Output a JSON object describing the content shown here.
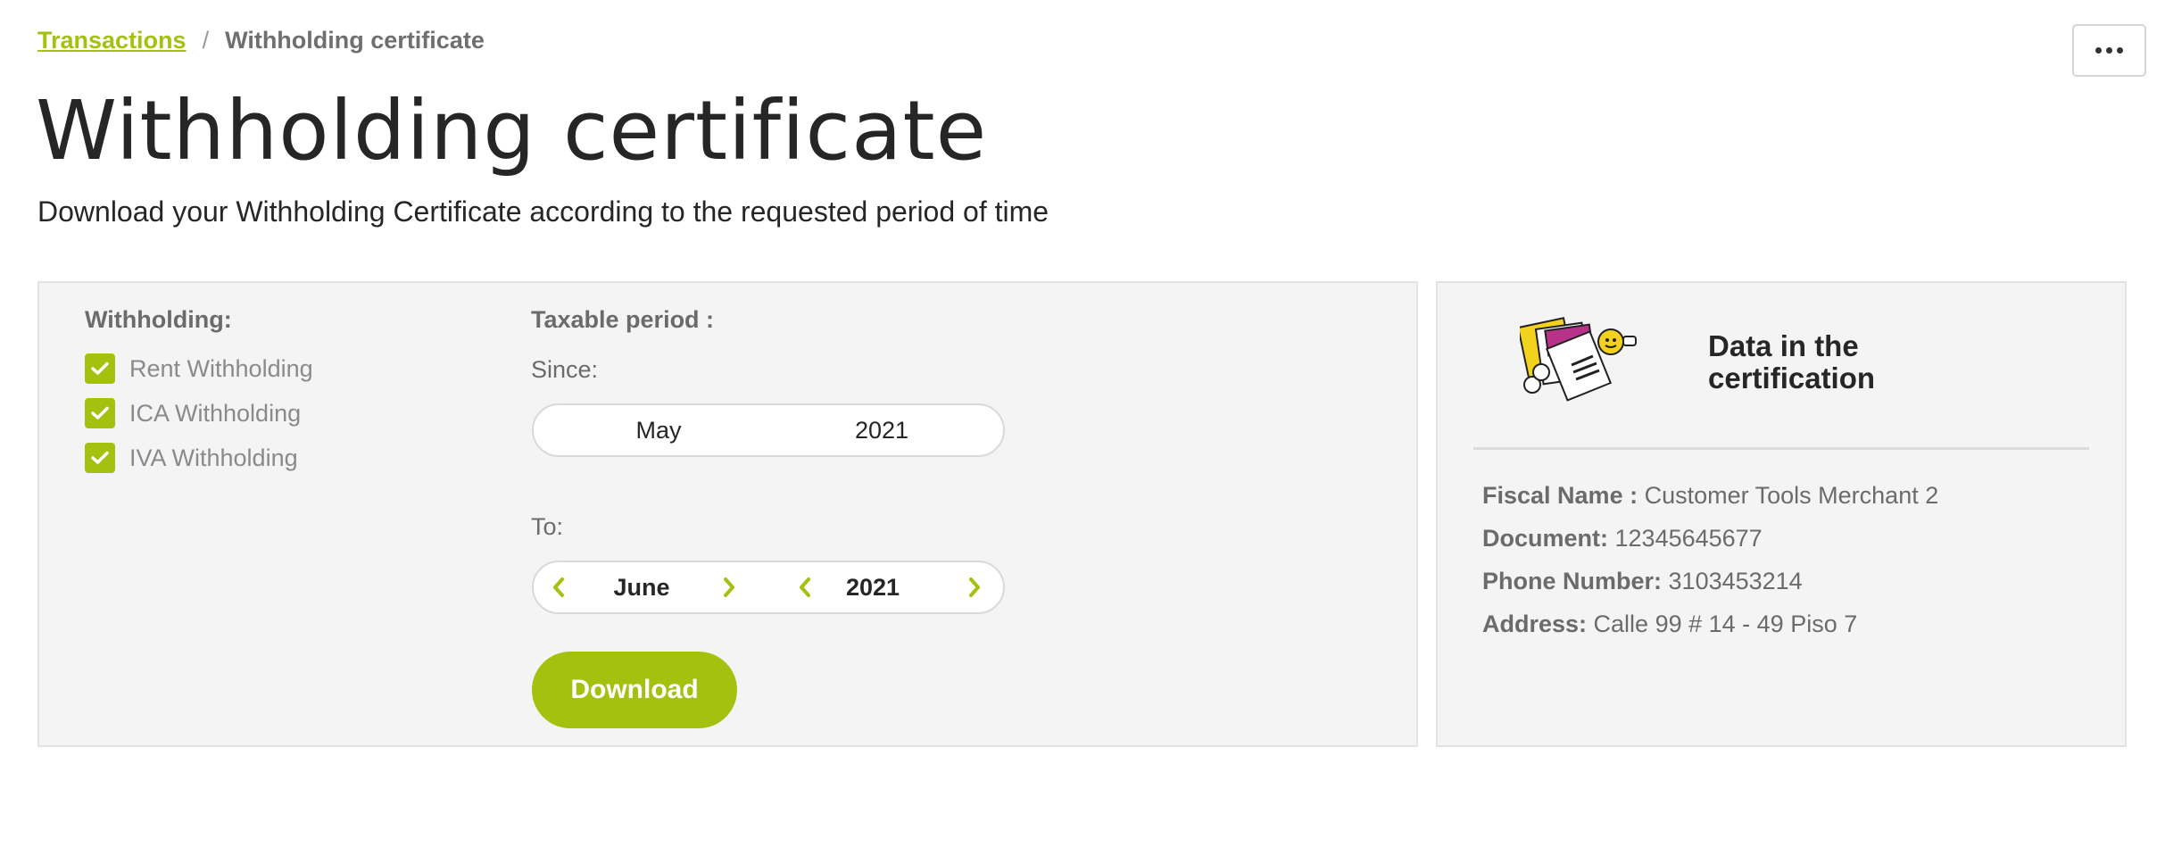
{
  "breadcrumb": {
    "link": "Transactions",
    "separator": "/",
    "current": "Withholding certificate"
  },
  "page": {
    "title": "Withholding certificate",
    "subtitle": "Download your Withholding Certificate according to the requested period of time"
  },
  "withholding": {
    "label": "Withholding:",
    "options": [
      {
        "label": "Rent Withholding",
        "checked": true
      },
      {
        "label": "ICA Withholding",
        "checked": true
      },
      {
        "label": "IVA Withholding",
        "checked": true
      }
    ]
  },
  "period": {
    "label": "Taxable period :",
    "since_label": "Since:",
    "since_month": "May",
    "since_year": "2021",
    "to_label": "To:",
    "to_month": "June",
    "to_year": "2021"
  },
  "actions": {
    "download_label": "Download"
  },
  "certification": {
    "title_line1": "Data in the",
    "title_line2": "certification",
    "fields": [
      {
        "key": "Fiscal Name :",
        "value": "Customer Tools Merchant 2"
      },
      {
        "key": "Document:",
        "value": "12345645677"
      },
      {
        "key": "Phone Number:",
        "value": "3103453214"
      },
      {
        "key": "Address:",
        "value": "Calle 99 # 14 - 49 Piso 7"
      }
    ]
  },
  "icons": {
    "more": "more-options-icon",
    "check": "check-icon",
    "chevron_left": "chevron-left-icon",
    "chevron_right": "chevron-right-icon",
    "illustration": "documents-illustration"
  },
  "colors": {
    "accent": "#a4c10f",
    "panel_bg": "#f4f4f4",
    "text_dark": "#262626",
    "text_muted": "#6b6b6b"
  }
}
